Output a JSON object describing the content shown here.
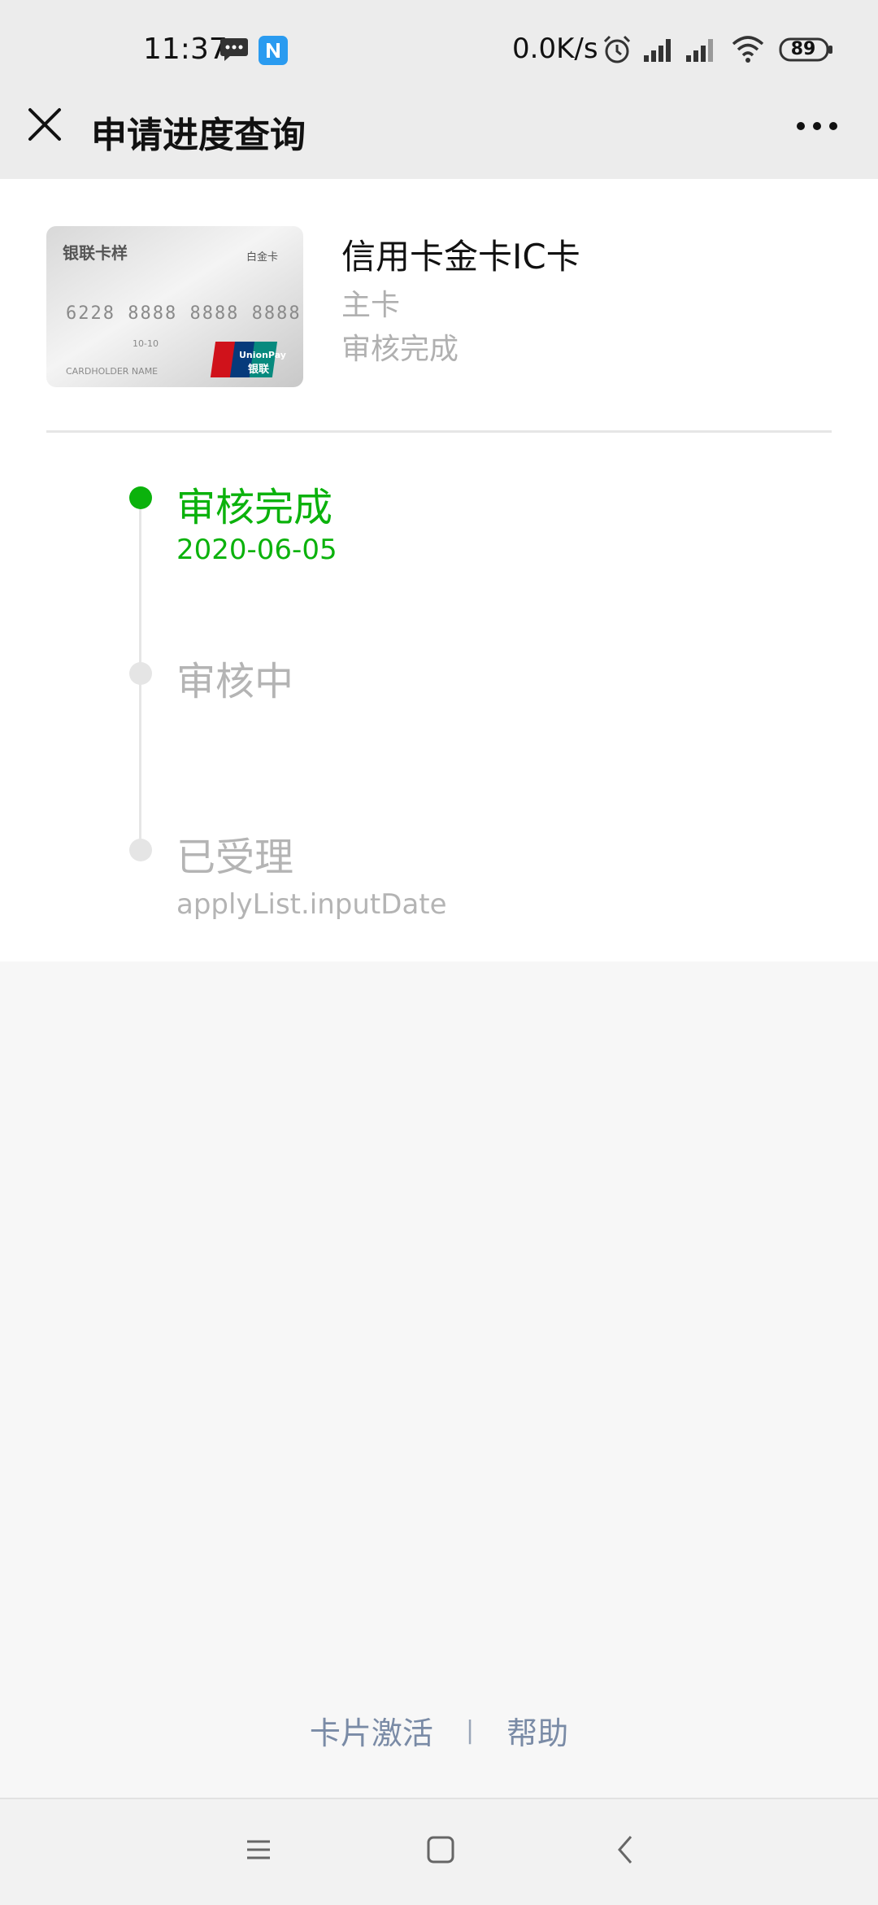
{
  "status_bar": {
    "time": "11:37",
    "net_speed": "0.0K/s",
    "battery": "89",
    "icons": [
      "message-icon",
      "app-n-icon",
      "alarm-icon",
      "signal-icon",
      "signal-icon",
      "wifi-icon",
      "battery-icon"
    ]
  },
  "nav": {
    "title": "申请进度查询",
    "close_icon": "close-icon",
    "more_icon": "more-icon"
  },
  "card": {
    "image_label": "银联卡样",
    "image_badge": "白金卡",
    "image_number": "6228 8888 8888 8888",
    "image_holder": "CARDHOLDER NAME",
    "image_valid": "10-10",
    "image_brand": "UnionPay",
    "image_brand_cn": "银联",
    "name": "信用卡金卡IC卡",
    "type": "主卡",
    "status": "审核完成"
  },
  "timeline": [
    {
      "title": "审核完成",
      "date": "2020-06-05",
      "active": true
    },
    {
      "title": "审核中",
      "date": "",
      "active": false
    },
    {
      "title": "已受理",
      "date": "applyList.inputDate",
      "active": false
    }
  ],
  "footer": {
    "activate_link": "卡片激活",
    "separator": "|",
    "help_link": "帮助"
  },
  "colors": {
    "accent_green": "#0bb20c",
    "muted_gray": "#b4b4b4",
    "link_blue_gray": "#7a8ba6"
  }
}
